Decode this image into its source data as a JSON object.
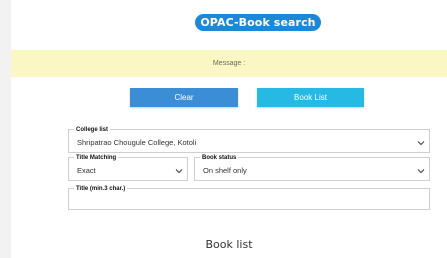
{
  "header": {
    "title": "OPAC-Book search"
  },
  "message": {
    "label": "Message :"
  },
  "buttons": {
    "clear": "Clear",
    "book_list": "Book List"
  },
  "form": {
    "college": {
      "label": "College list",
      "value": "Shripatrao Chougule College, Kotoli"
    },
    "title_matching": {
      "label": "Title Matching",
      "value": "Exact"
    },
    "book_status": {
      "label": "Book status",
      "value": "On shelf only"
    },
    "title": {
      "label": "Title (min.3 char.)",
      "value": ""
    }
  },
  "results": {
    "heading": "Book list"
  },
  "colors": {
    "badge": "#1e88d8",
    "message_bg": "#fbf7c4",
    "clear_button": "#3b8ed6",
    "book_list_button": "#26b9e4"
  },
  "icons": {
    "dropdown": "chevron-down-icon"
  }
}
